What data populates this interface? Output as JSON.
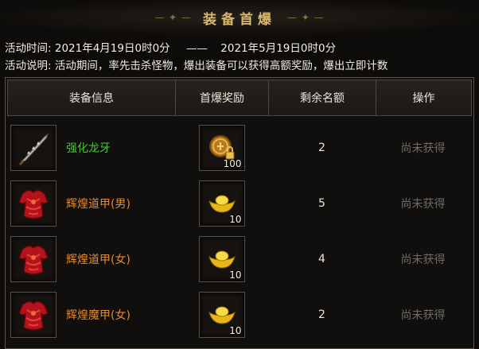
{
  "header": {
    "title": "装备首爆",
    "deco_left": "— ✦ —",
    "deco_right": "— ✦ —"
  },
  "activity": {
    "time_label": "活动时间:",
    "start": "2021年4月19日0时0分",
    "separator": "——",
    "end": "2021年5月19日0时0分",
    "desc_label": "活动说明:",
    "desc": "活动期间，率先击杀怪物，爆出装备可以获得高额奖励，爆出立即计数"
  },
  "table": {
    "columns": [
      "装备信息",
      "首爆奖励",
      "剩余名额",
      "操作"
    ],
    "rows": [
      {
        "item": "强化龙牙",
        "item_icon": "dragon-tooth-sword-icon",
        "name_color": "#49c53c",
        "reward_icon": "locked-coin-icon",
        "reward_count": "100",
        "remaining": "2",
        "action": "尚未获得"
      },
      {
        "item": "辉煌道甲(男)",
        "item_icon": "red-armor-icon",
        "name_color": "#e58a2e",
        "reward_icon": "gold-ingot-icon",
        "reward_count": "10",
        "remaining": "5",
        "action": "尚未获得"
      },
      {
        "item": "辉煌道甲(女)",
        "item_icon": "red-armor-icon",
        "name_color": "#e58a2e",
        "reward_icon": "gold-ingot-icon",
        "reward_count": "10",
        "remaining": "4",
        "action": "尚未获得"
      },
      {
        "item": "辉煌魔甲(女)",
        "item_icon": "red-armor-icon",
        "name_color": "#e58a2e",
        "reward_icon": "gold-ingot-icon",
        "reward_count": "10",
        "remaining": "2",
        "action": "尚未获得"
      }
    ]
  }
}
